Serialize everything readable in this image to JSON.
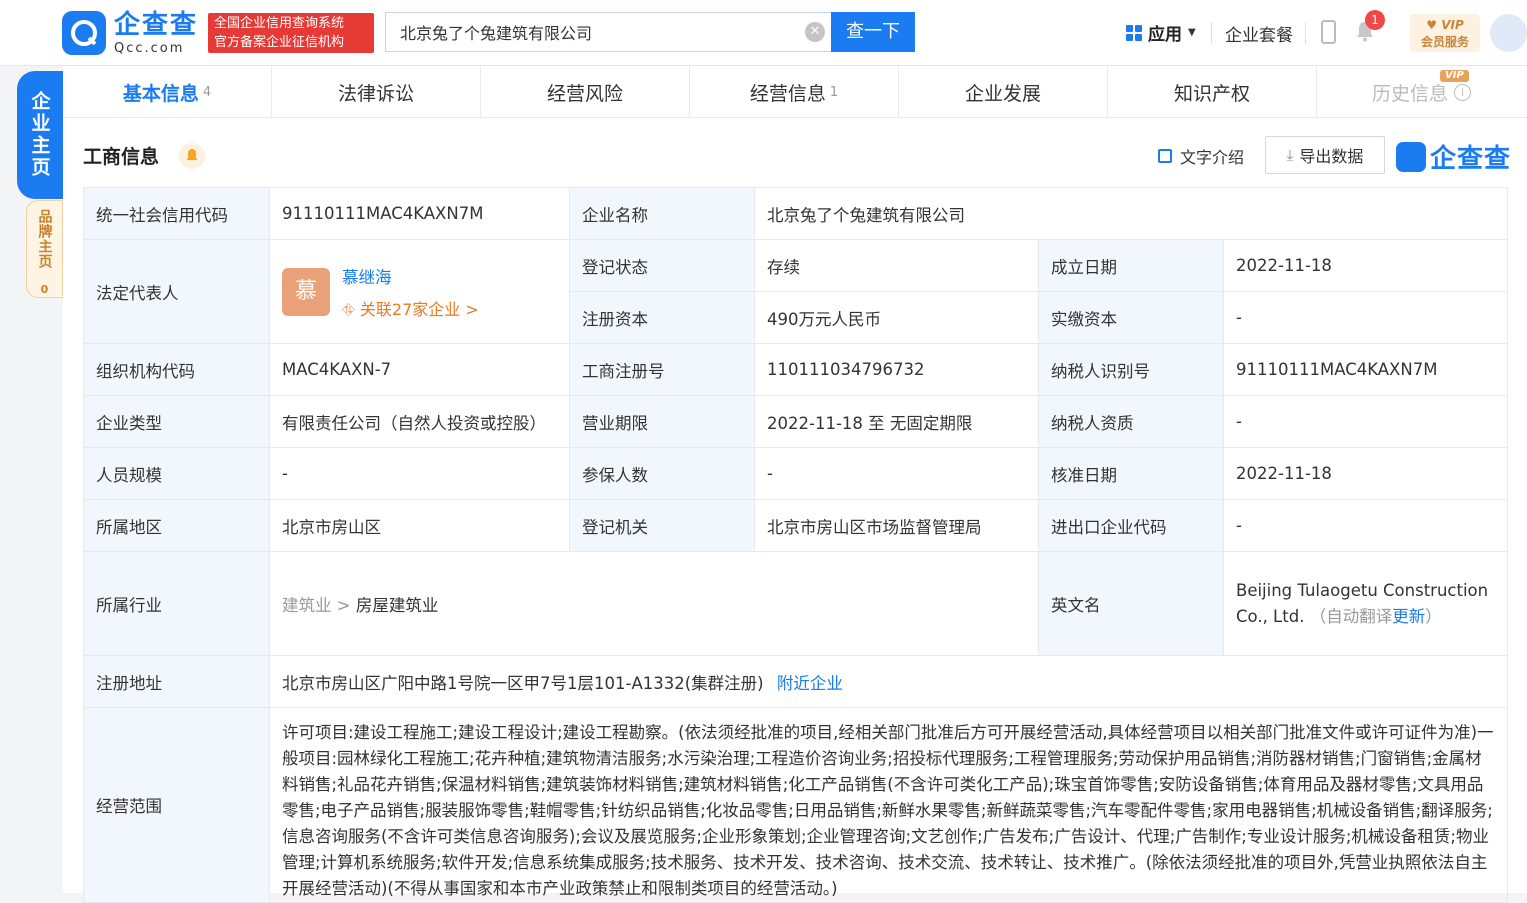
{
  "header": {
    "logo_cn": "企查查",
    "logo_en": "Qcc.com",
    "logo_badge_line1": "全国企业信用查询系统",
    "logo_badge_line2": "官方备案企业征信机构",
    "search_value": "北京兔了个兔建筑有限公司",
    "search_button": "查一下",
    "apps_label": "应用",
    "suite_label": "企业套餐",
    "notification_count": "1",
    "vip_top": "VIP",
    "vip_bottom": "会员服务"
  },
  "side_tabs": {
    "main": "企业主页",
    "brand": "品牌主页",
    "brand_count": "0"
  },
  "tabs": [
    {
      "label": "基本信息",
      "count": "4"
    },
    {
      "label": "法律诉讼",
      "count": ""
    },
    {
      "label": "经营风险",
      "count": ""
    },
    {
      "label": "经营信息",
      "count": "1"
    },
    {
      "label": "企业发展",
      "count": ""
    },
    {
      "label": "知识产权",
      "count": ""
    },
    {
      "label": "历史信息",
      "count": "",
      "vip": "VIP"
    }
  ],
  "section": {
    "title": "工商信息",
    "text_intro": "文字介绍",
    "export": "导出数据",
    "watermark": "企查查"
  },
  "info": {
    "credit_code_label": "统一社会信用代码",
    "credit_code": "91110111MAC4KAXN7M",
    "company_name_label": "企业名称",
    "company_name": "北京兔了个兔建筑有限公司",
    "legal_rep_label": "法定代表人",
    "legal_rep_avatar": "慕",
    "legal_rep_name": "慕继海",
    "legal_rep_related": "关联27家企业 >",
    "reg_status_label": "登记状态",
    "reg_status": "存续",
    "est_date_label": "成立日期",
    "est_date": "2022-11-18",
    "reg_capital_label": "注册资本",
    "reg_capital": "490万元人民币",
    "paid_capital_label": "实缴资本",
    "paid_capital": "-",
    "org_code_label": "组织机构代码",
    "org_code": "MAC4KAXN-7",
    "biz_reg_no_label": "工商注册号",
    "biz_reg_no": "110111034796732",
    "taxpayer_id_label": "纳税人识别号",
    "taxpayer_id": "91110111MAC4KAXN7M",
    "company_type_label": "企业类型",
    "company_type": "有限责任公司（自然人投资或控股）",
    "biz_term_label": "营业期限",
    "biz_term": "2022-11-18 至 无固定期限",
    "taxpayer_qual_label": "纳税人资质",
    "taxpayer_qual": "-",
    "staff_size_label": "人员规模",
    "staff_size": "-",
    "insured_label": "参保人数",
    "insured": "-",
    "approval_date_label": "核准日期",
    "approval_date": "2022-11-18",
    "region_label": "所属地区",
    "region": "北京市房山区",
    "reg_authority_label": "登记机关",
    "reg_authority": "北京市房山区市场监督管理局",
    "import_export_label": "进出口企业代码",
    "import_export": "-",
    "industry_label": "所属行业",
    "industry_parent": "建筑业",
    "industry_sep": ">",
    "industry_child": "房屋建筑业",
    "english_name_label": "英文名",
    "english_name_1": "Beijing Tulaogetu Construction",
    "english_name_2": "Co., Ltd.",
    "english_auto": "（自动翻译",
    "english_update": "更新",
    "english_close": "）",
    "address_label": "注册地址",
    "address": "北京市房山区广阳中路1号院一区甲7号1层101-A1332(集群注册)",
    "nearby": "附近企业",
    "scope_label": "经营范围",
    "scope": "许可项目:建设工程施工;建设工程设计;建设工程勘察。(依法须经批准的项目,经相关部门批准后方可开展经营活动,具体经营项目以相关部门批准文件或许可证件为准)一般项目:园林绿化工程施工;花卉种植;建筑物清洁服务;水污染治理;工程造价咨询业务;招投标代理服务;工程管理服务;劳动保护用品销售;消防器材销售;门窗销售;金属材料销售;礼品花卉销售;保温材料销售;建筑装饰材料销售;建筑材料销售;化工产品销售(不含许可类化工产品);珠宝首饰零售;安防设备销售;体育用品及器材零售;文具用品零售;电子产品销售;服装服饰零售;鞋帽零售;针纺织品销售;化妆品零售;日用品销售;新鲜水果零售;新鲜蔬菜零售;汽车零配件零售;家用电器销售;机械设备销售;翻译服务;信息咨询服务(不含许可类信息咨询服务);会议及展览服务;企业形象策划;企业管理咨询;文艺创作;广告发布;广告设计、代理;广告制作;专业设计服务;机械设备租赁;物业管理;计算机系统服务;软件开发;信息系统集成服务;技术服务、技术开发、技术咨询、技术交流、技术转让、技术推广。(除依法须经批准的项目外,凭营业执照依法自主开展经营活动)(不得从事国家和本市产业政策禁止和限制类项目的经营活动。)"
  },
  "colors": {
    "brand_blue": "#1a7cf0",
    "label_bg": "#f2f7fd",
    "badge_red": "#e63a37",
    "orange": "#f0781e"
  }
}
